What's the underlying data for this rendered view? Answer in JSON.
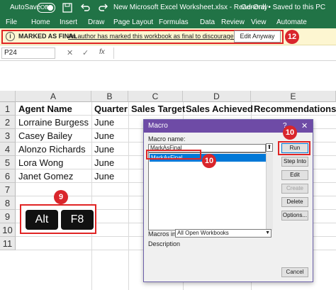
{
  "titlebar": {
    "autosave_label": "AutoSave",
    "autosave_state": "Off",
    "document_title": "New Microsoft Excel Worksheet.xlsx - Read-Only",
    "status": "General • Saved to this PC"
  },
  "ribbon": {
    "tabs": [
      "File",
      "Home",
      "Insert",
      "Draw",
      "Page Layout",
      "Formulas",
      "Data",
      "Review",
      "View",
      "Automate"
    ]
  },
  "infobar": {
    "label": "MARKED AS FINAL",
    "message": "An author has marked this workbook as final to discourage editing.",
    "button": "Edit Anyway",
    "badge": "12"
  },
  "formula_bar": {
    "name_box": "P24",
    "cancel_icon": "✕",
    "enter_icon": "✓",
    "fx": "fx"
  },
  "sheet": {
    "columns": [
      "A",
      "B",
      "C",
      "D",
      "E"
    ],
    "rows": [
      "1",
      "2",
      "3",
      "4",
      "5",
      "6",
      "7",
      "8",
      "9",
      "10",
      "11"
    ],
    "header_row": [
      "Agent Name",
      "Quarter",
      "Sales Target",
      "Sales Achieved",
      "Recommendations"
    ],
    "data": [
      [
        "Lorraine Burgess",
        "June"
      ],
      [
        "Casey Bailey",
        "June"
      ],
      [
        "Alonzo Richards",
        "June"
      ],
      [
        "Lora Wong",
        "June"
      ],
      [
        "Janet Gomez",
        "June"
      ]
    ]
  },
  "keys": {
    "badge": "9",
    "key1": "Alt",
    "key2": "F8"
  },
  "dialog": {
    "title": "Macro",
    "help": "?",
    "close": "✕",
    "macro_name_label": "Macro name:",
    "macro_name_value": "MarkAsFinal",
    "list_items": [
      "MarkAsFinal"
    ],
    "list_badge": "10",
    "run_badge": "10",
    "buttons": {
      "run": "Run",
      "step_into": "Step Into",
      "edit": "Edit",
      "create": "Create",
      "delete": "Delete",
      "options": "Options...",
      "cancel": "Cancel"
    },
    "macros_in_label": "Macros in:",
    "macros_in_value": "All Open Workbooks",
    "description_label": "Description"
  },
  "colors": {
    "excel_green": "#217346",
    "dialog_title": "#6e4ba6",
    "badge_red": "#d9262c",
    "selection_blue": "#0078d7"
  }
}
